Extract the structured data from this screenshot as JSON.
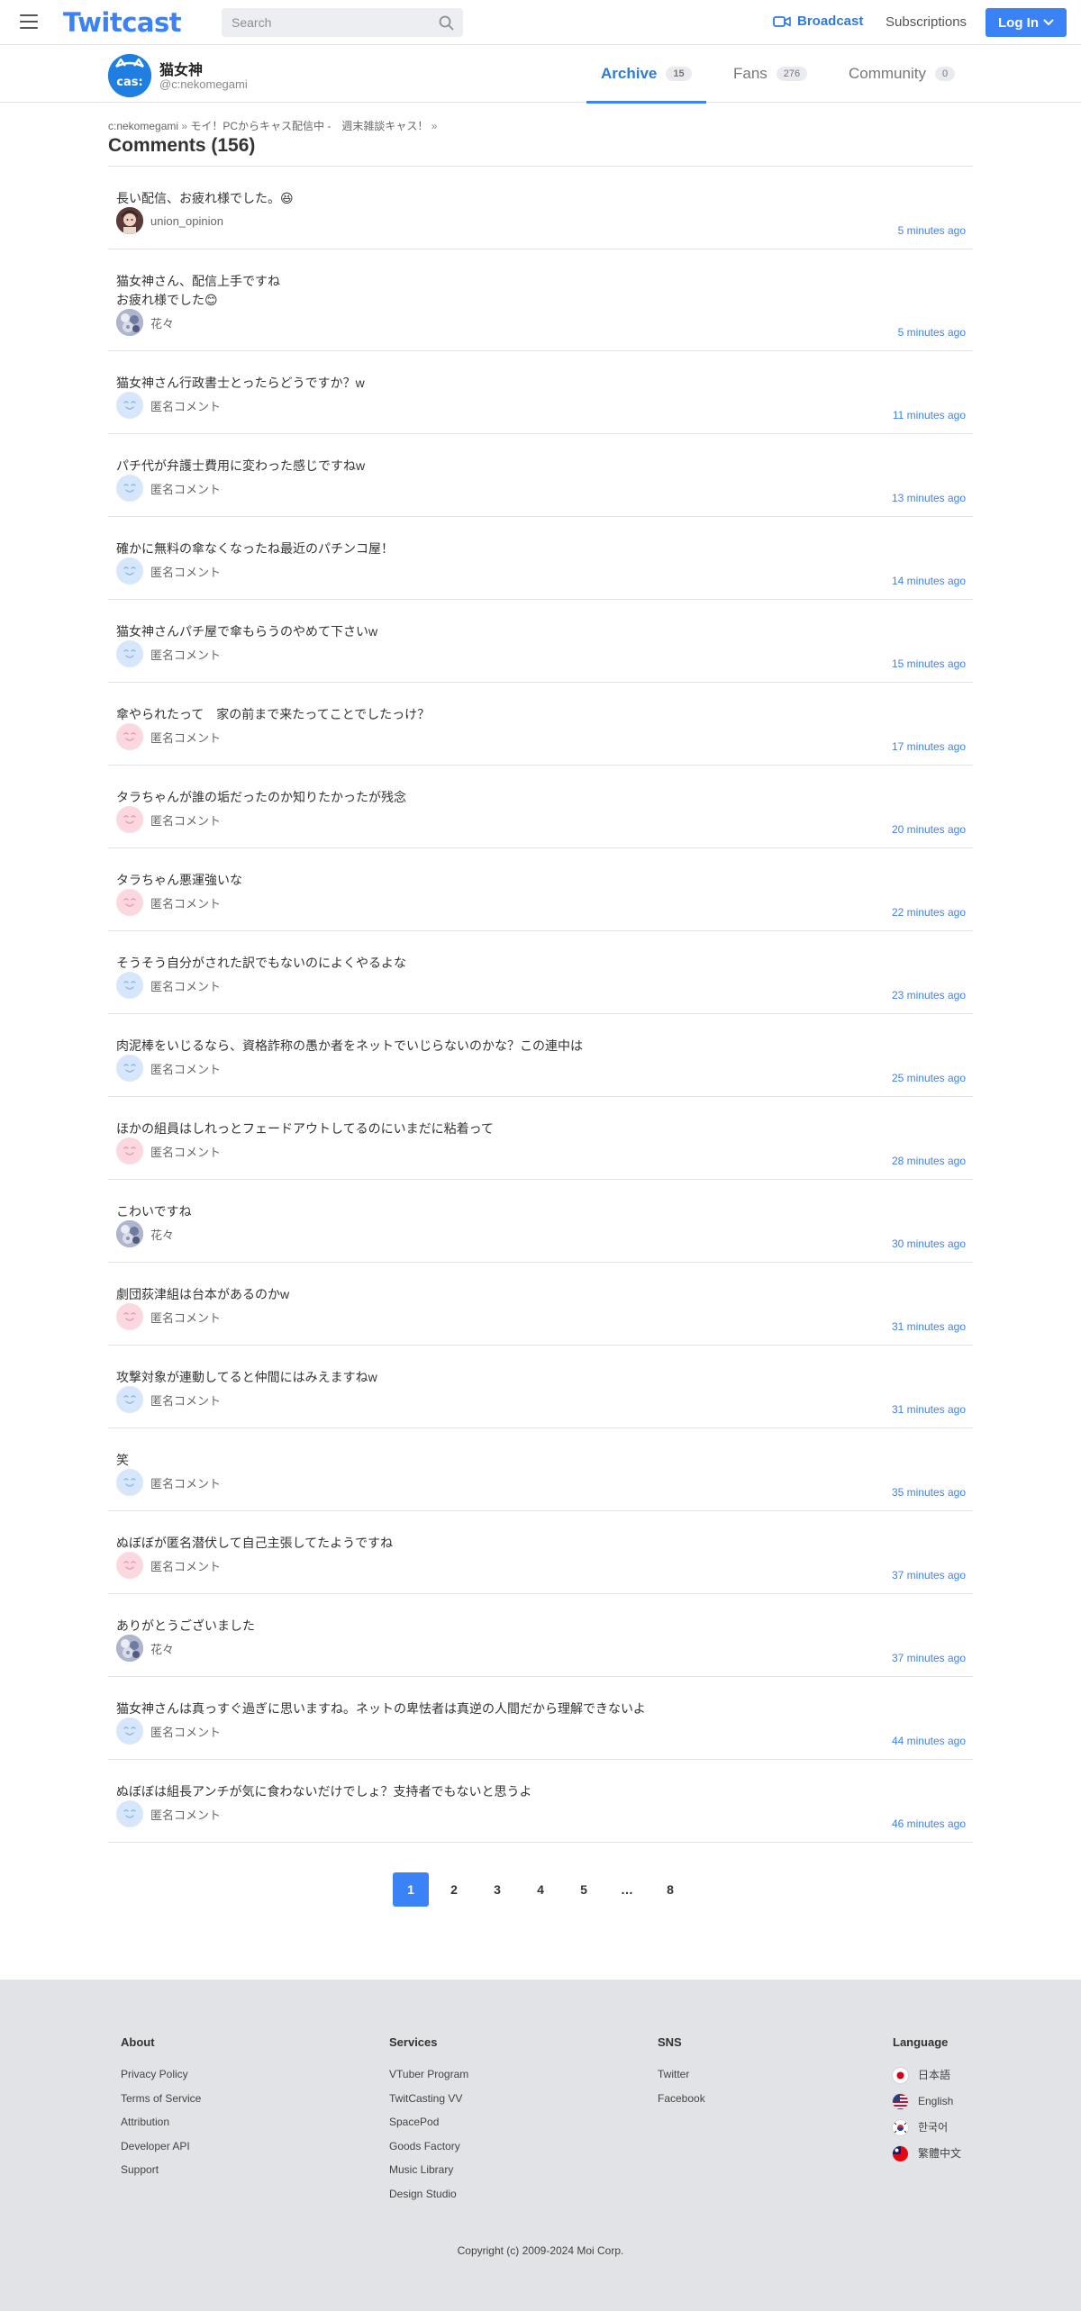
{
  "header": {
    "logo": "Twitcast",
    "search_placeholder": "Search",
    "broadcast": "Broadcast",
    "subscriptions": "Subscriptions",
    "login": "Log In"
  },
  "profile": {
    "name": "猫女神",
    "handle": "@c:nekomegami",
    "avatar_text": "cas:",
    "tabs": [
      {
        "label": "Archive",
        "count": "15"
      },
      {
        "label": "Fans",
        "count": "276"
      },
      {
        "label": "Community",
        "count": "0"
      }
    ]
  },
  "breadcrumb": {
    "user": "c:nekomegami",
    "sep1": " » ",
    "movie": "モイ！PCからキャス配信中 -　週末雑談キャス！",
    "sep2": " »"
  },
  "comments_title": "Comments (156)",
  "comments": [
    {
      "text": "長い配信、お疲れ様でした。😆",
      "user": "union_opinion",
      "avatar": "photo",
      "time": "5 minutes ago"
    },
    {
      "text": "猫女神さん、配信上手ですね\nお疲れ様でした😊",
      "user": "花々",
      "avatar": "flower",
      "time": "5 minutes ago"
    },
    {
      "text": "猫女神さん行政書士とったらどうですか？w",
      "user": "匿名コメント",
      "avatar": "blue",
      "time": "11 minutes ago"
    },
    {
      "text": "パチ代が弁護士費用に変わった感じですねw",
      "user": "匿名コメント",
      "avatar": "blue",
      "time": "13 minutes ago"
    },
    {
      "text": "確かに無料の傘なくなったね最近のパチンコ屋！",
      "user": "匿名コメント",
      "avatar": "blue",
      "time": "14 minutes ago"
    },
    {
      "text": "猫女神さんパチ屋で傘もらうのやめて下さいw",
      "user": "匿名コメント",
      "avatar": "blue",
      "time": "15 minutes ago"
    },
    {
      "text": "傘やられたって　家の前まで来たってことでしたっけ？",
      "user": "匿名コメント",
      "avatar": "pink",
      "time": "17 minutes ago"
    },
    {
      "text": "タラちゃんが誰の垢だったのか知りたかったが残念",
      "user": "匿名コメント",
      "avatar": "pink",
      "time": "20 minutes ago"
    },
    {
      "text": "タラちゃん悪運強いな",
      "user": "匿名コメント",
      "avatar": "pink",
      "time": "22 minutes ago"
    },
    {
      "text": "そうそう自分がされた訳でもないのによくやるよな",
      "user": "匿名コメント",
      "avatar": "blue",
      "time": "23 minutes ago"
    },
    {
      "text": "肉泥棒をいじるなら、資格詐称の愚か者をネットでいじらないのかな？この連中は",
      "user": "匿名コメント",
      "avatar": "blue",
      "time": "25 minutes ago"
    },
    {
      "text": "ほかの組員はしれっとフェードアウトしてるのにいまだに粘着って",
      "user": "匿名コメント",
      "avatar": "pink",
      "time": "28 minutes ago"
    },
    {
      "text": "こわいですね",
      "user": "花々",
      "avatar": "flower",
      "time": "30 minutes ago"
    },
    {
      "text": "劇団荻津組は台本があるのかw",
      "user": "匿名コメント",
      "avatar": "pink",
      "time": "31 minutes ago"
    },
    {
      "text": "攻撃対象が連動してると仲間にはみえますねw",
      "user": "匿名コメント",
      "avatar": "blue",
      "time": "31 minutes ago"
    },
    {
      "text": "笑",
      "user": "匿名コメント",
      "avatar": "blue",
      "time": "35 minutes ago"
    },
    {
      "text": "ぬぼぼが匿名潜伏して自己主張してたようですね",
      "user": "匿名コメント",
      "avatar": "pink",
      "time": "37 minutes ago"
    },
    {
      "text": "ありがとうございました",
      "user": "花々",
      "avatar": "flower",
      "time": "37 minutes ago"
    },
    {
      "text": "猫女神さんは真っすぐ過ぎに思いますね。ネットの卑怯者は真逆の人間だから理解できないよ",
      "user": "匿名コメント",
      "avatar": "blue",
      "time": "44 minutes ago"
    },
    {
      "text": "ぬぼぼは組長アンチが気に食わないだけでしょ？支持者でもないと思うよ",
      "user": "匿名コメント",
      "avatar": "blue",
      "time": "46 minutes ago"
    }
  ],
  "pagination": [
    "1",
    "2",
    "3",
    "4",
    "5",
    "…",
    "8"
  ],
  "footer": {
    "about": {
      "title": "About",
      "links": [
        "Privacy Policy",
        "Terms of Service",
        "Attribution",
        "Developer API",
        "Support"
      ]
    },
    "services": {
      "title": "Services",
      "links": [
        "VTuber Program",
        "TwitCasting VV",
        "SpacePod",
        "Goods Factory",
        "Music Library",
        "Design Studio"
      ]
    },
    "sns": {
      "title": "SNS",
      "links": [
        "Twitter",
        "Facebook"
      ]
    },
    "language": {
      "title": "Language",
      "items": [
        "日本語",
        "English",
        "한국어",
        "繁體中文"
      ]
    },
    "copyright": "Copyright (c) 2009-2024 Moi Corp."
  },
  "colors": {
    "accent": "#3b82f6",
    "link_time": "#3b82f6",
    "footer_bg": "#e1e3e6"
  }
}
